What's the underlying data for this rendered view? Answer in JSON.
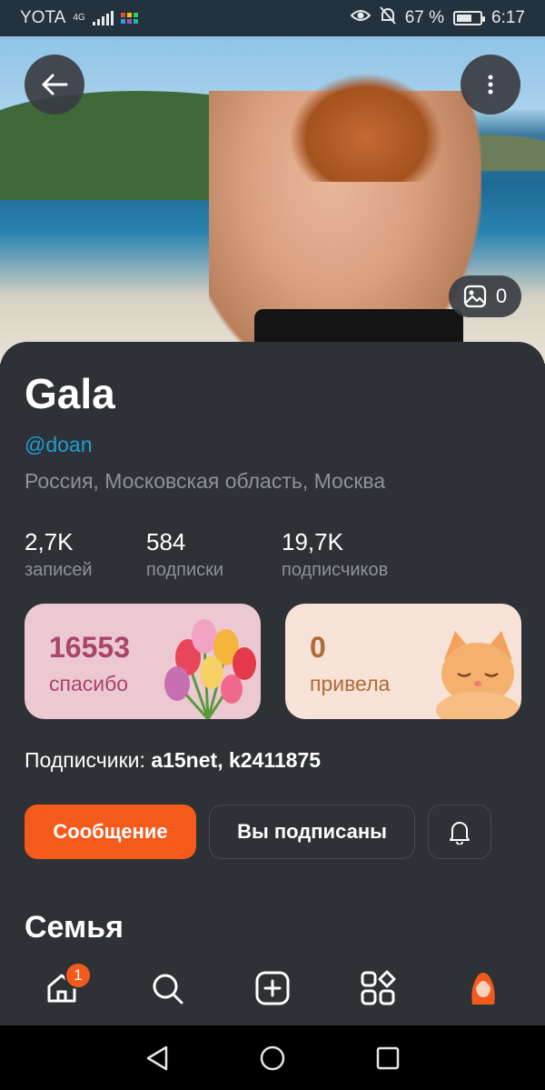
{
  "status_bar": {
    "carrier": "YOTA",
    "network": "4G",
    "battery": "67 %",
    "battery_level": 0.67,
    "time": "6:17"
  },
  "cover": {
    "photo_count": "0"
  },
  "profile": {
    "name": "Gala",
    "handle": "@doan",
    "location": "Россия, Московская область, Москва"
  },
  "stats": [
    {
      "value": "2,7K",
      "label": "записей"
    },
    {
      "value": "584",
      "label": "подписки"
    },
    {
      "value": "19,7K",
      "label": "подписчиков"
    }
  ],
  "cards": {
    "thanks": {
      "value": "16553",
      "label": "спасибо"
    },
    "hello": {
      "value": "0",
      "label": "привела"
    }
  },
  "subscribers": {
    "prefix": "Подписчики:",
    "user1": "a15net",
    "separator": ",",
    "user2": "k2411875"
  },
  "actions": {
    "message": "Сообщение",
    "subscribed": "Вы подписаны"
  },
  "section_title": "Семья",
  "tabbar": {
    "home_badge": "1"
  },
  "colors": {
    "accent": "#f45a1c",
    "link": "#1e9ed8",
    "background": "#2e3136"
  }
}
